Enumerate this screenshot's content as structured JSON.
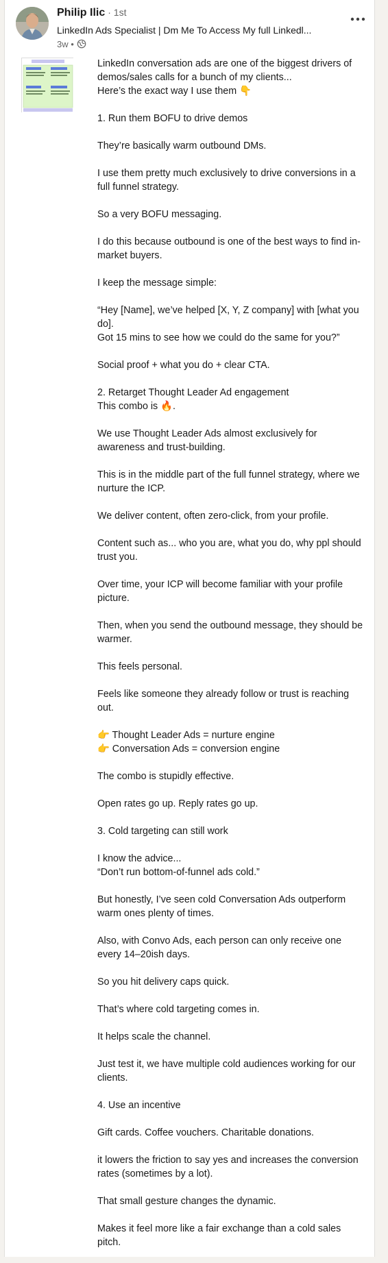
{
  "post": {
    "author": {
      "name": "Philip Ilic",
      "degree": "· 1st",
      "headline": "LinkedIn Ads Specialist | Dm Me To Access My full Linkedl...",
      "time": "3w •"
    },
    "icons": {
      "visibility": "globe-icon",
      "menu": "more-icon"
    },
    "paragraphs": [
      [
        "LinkedIn conversation ads are one of the biggest drivers of",
        "demos/sales calls for a bunch of my clients...",
        "Here’s the exact way I use them 👇"
      ],
      [
        "1. Run them BOFU to drive demos"
      ],
      [
        "They’re basically warm outbound DMs."
      ],
      [
        "I use them pretty much exclusively to drive conversions in a",
        "full funnel strategy."
      ],
      [
        "So a very BOFU messaging."
      ],
      [
        "I do this because outbound is one of the best ways to find in-",
        "market buyers."
      ],
      [
        "I keep the message simple:"
      ],
      [
        "“Hey [Name], we’ve helped [X, Y, Z company] with [what you",
        "do].",
        "Got 15 mins to see how we could do the same for you?”"
      ],
      [
        "Social proof + what you do + clear CTA."
      ],
      [
        "2. Retarget Thought Leader Ad engagement",
        "This combo is 🔥."
      ],
      [
        "We use Thought Leader Ads almost exclusively for",
        "awareness and trust-building."
      ],
      [
        "This is in the middle part of the full funnel strategy, where we",
        "nurture the ICP."
      ],
      [
        "We deliver content, often zero-click, from your profile."
      ],
      [
        "Content such as... who you are, what you do, why ppl should",
        "trust you."
      ],
      [
        "Over time, your ICP will become familiar with your profile",
        "picture."
      ],
      [
        "Then, when you send the outbound message, they should be",
        "warmer."
      ],
      [
        "This feels personal."
      ],
      [
        "Feels like someone they already follow or trust is reaching",
        "out."
      ],
      [
        "👉 Thought Leader Ads = nurture engine",
        "👉 Conversation Ads = conversion engine"
      ],
      [
        "The combo is stupidly effective."
      ],
      [
        "Open rates go up. Reply rates go up."
      ],
      [
        "3. Cold targeting can still work"
      ],
      [
        "I know the advice...",
        "“Don’t run bottom-of-funnel ads cold.”"
      ],
      [
        "But honestly, I’ve seen cold Conversation Ads outperform",
        "warm ones plenty of times."
      ],
      [
        "Also, with Convo Ads, each person can only receive one",
        "every 14–20ish days."
      ],
      [
        "So you hit delivery caps quick."
      ],
      [
        "That’s where cold targeting comes in."
      ],
      [
        "It helps scale the channel."
      ],
      [
        "Just test it, we have multiple cold audiences working for our",
        "clients."
      ],
      [
        "4. Use an incentive"
      ],
      [
        "Gift cards. Coffee vouchers. Charitable donations."
      ],
      [
        "it lowers the friction to say yes and increases the conversion",
        "rates (sometimes by a lot)."
      ],
      [
        "That small gesture changes the dynamic."
      ],
      [
        "Makes it feel more like a fair exchange than a cold sales",
        "pitch."
      ]
    ]
  }
}
